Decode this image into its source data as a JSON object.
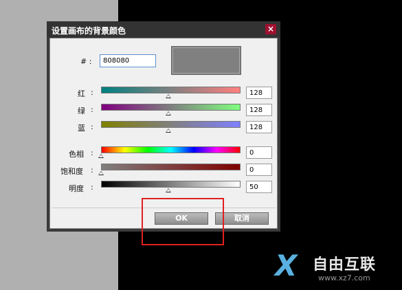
{
  "dialog": {
    "title": "设置画布的背景颜色",
    "close_icon": "×",
    "hex_label": "# :",
    "hex_value": "808080",
    "preview_color": "#808080",
    "rows": [
      {
        "label": "红",
        "colon": ":",
        "value": "128"
      },
      {
        "label": "绿",
        "colon": ":",
        "value": "128"
      },
      {
        "label": "蓝",
        "colon": ":",
        "value": "128"
      },
      {
        "label": "色相",
        "colon": ":",
        "value": "0"
      },
      {
        "label": "饱和度",
        "colon": ":",
        "value": "0"
      },
      {
        "label": "明度",
        "colon": ":",
        "value": "50"
      }
    ],
    "ok_label": "OK",
    "cancel_label": "取消"
  },
  "watermark": {
    "logo": "X",
    "text": "自由互联",
    "url": "www.xz7.com"
  },
  "colors": {
    "titlebar": "#333333",
    "close": "#a01030",
    "highlight": "#e02020"
  }
}
